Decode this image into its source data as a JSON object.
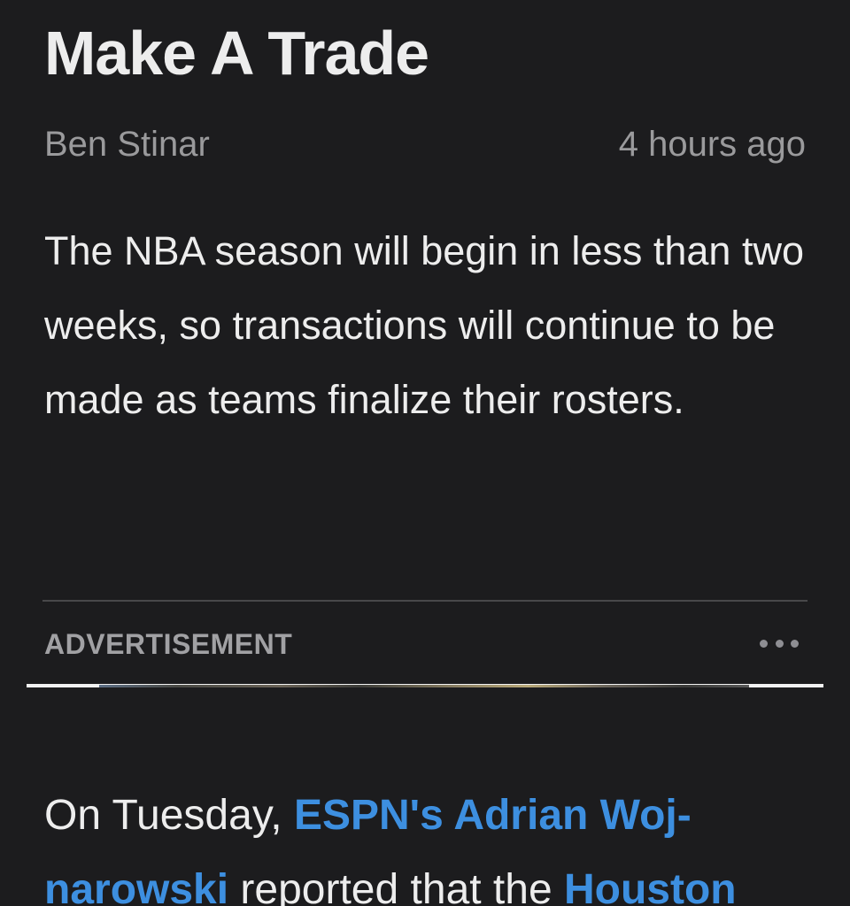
{
  "article": {
    "headline": "Make A Trade",
    "author": "Ben Stinar",
    "timestamp": "4 hours ago",
    "intro": "The NBA season will begin in less than two weeks, so transactions will continue to be made as teams finalize their rosters.",
    "ad": {
      "label": "ADVERTISEMENT",
      "more_icon": "ellipsis-icon"
    },
    "body": {
      "text_1": "On Tuesday, ",
      "link_1": "ESPN's Adrian Woj-narowski",
      "text_2": " reported that the ",
      "link_2": "Houston"
    }
  },
  "colors": {
    "background": "#1c1c1e",
    "text": "#ededed",
    "muted": "#9a9a9c",
    "link": "#3d8fe0",
    "divider": "#48484a"
  }
}
